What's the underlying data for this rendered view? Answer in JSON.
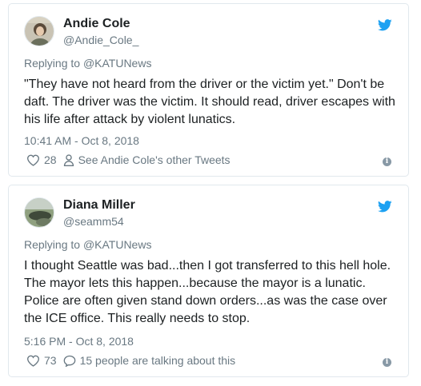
{
  "colors": {
    "brand_blue": "#1da1f2",
    "secondary_text": "#697882",
    "primary_text": "#1c2022",
    "border": "#e1e8ed"
  },
  "tweets": [
    {
      "name": "Andie Cole",
      "handle": "@Andie_Cole_",
      "reply_prefix": "Replying to",
      "reply_to": "@KATUNews",
      "text": "\"They have not heard from the driver or the victim yet.\" Don't be daft. The driver was the victim. It should read, driver escapes with his life after attack by violent lunatics.",
      "timestamp": "10:41 AM - Oct 8, 2018",
      "likes": "28",
      "secondary_action": "See Andie Cole's other Tweets",
      "secondary_icon": "person-icon"
    },
    {
      "name": "Diana Miller",
      "handle": "@seamm54",
      "reply_prefix": "Replying to",
      "reply_to": "@KATUNews",
      "text": "I thought Seattle was bad...then I got transferred to this hell hole.  The mayor lets this happen...because the mayor is a lunatic.  Police are often given stand down orders...as was the case over the ICE office.  This really needs to stop.",
      "timestamp": "5:16 PM - Oct 8, 2018",
      "likes": "73",
      "secondary_action": "15 people are talking about this",
      "secondary_icon": "comment-icon"
    }
  ]
}
